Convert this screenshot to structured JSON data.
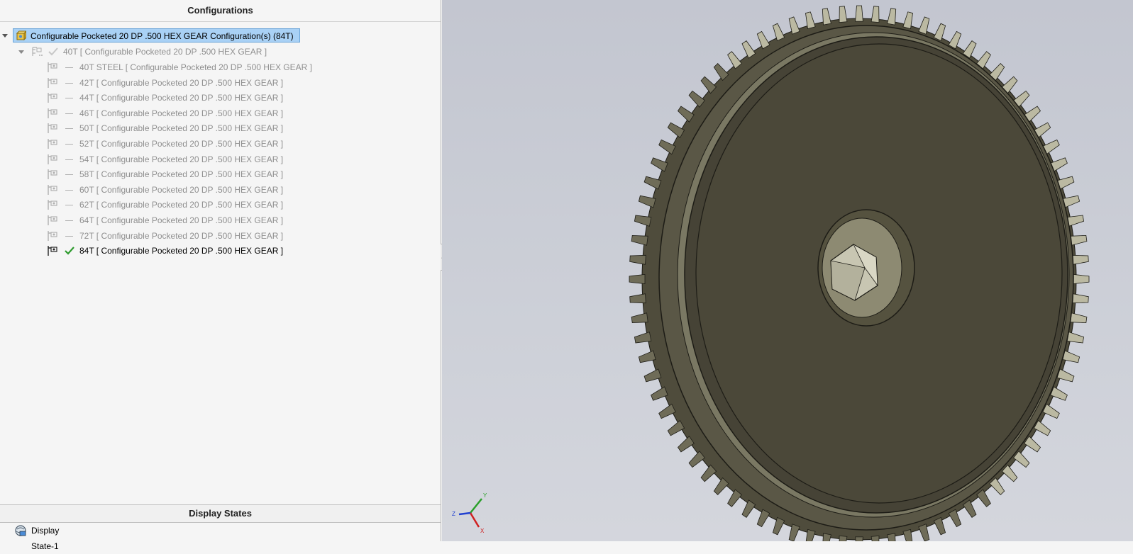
{
  "configurations_panel": {
    "header": "Configurations",
    "root": {
      "label": "Configurable Pocketed 20 DP .500 HEX GEAR Configuration(s)  (84T)"
    },
    "parent": {
      "label": "40T [ Configurable Pocketed 20 DP .500 HEX GEAR ]"
    },
    "items": [
      {
        "label": "40T STEEL [ Configurable Pocketed 20 DP .500 HEX GEAR ]",
        "active": false
      },
      {
        "label": "42T [ Configurable Pocketed 20 DP .500 HEX GEAR ]",
        "active": false
      },
      {
        "label": "44T [ Configurable Pocketed 20 DP .500 HEX GEAR ]",
        "active": false
      },
      {
        "label": "46T [ Configurable Pocketed 20 DP .500 HEX GEAR ]",
        "active": false
      },
      {
        "label": "50T [ Configurable Pocketed 20 DP .500 HEX GEAR ]",
        "active": false
      },
      {
        "label": "52T [ Configurable Pocketed 20 DP .500 HEX GEAR ]",
        "active": false
      },
      {
        "label": "54T [ Configurable Pocketed 20 DP .500 HEX GEAR ]",
        "active": false
      },
      {
        "label": "58T [ Configurable Pocketed 20 DP .500 HEX GEAR ]",
        "active": false
      },
      {
        "label": "60T [ Configurable Pocketed 20 DP .500 HEX GEAR ]",
        "active": false
      },
      {
        "label": "62T [ Configurable Pocketed 20 DP .500 HEX GEAR ]",
        "active": false
      },
      {
        "label": "64T [ Configurable Pocketed 20 DP .500 HEX GEAR ]",
        "active": false
      },
      {
        "label": "72T [ Configurable Pocketed 20 DP .500 HEX GEAR ]",
        "active": false
      },
      {
        "label": "84T [ Configurable Pocketed 20 DP .500 HEX GEAR ]",
        "active": true
      }
    ]
  },
  "display_states_panel": {
    "header": "Display States",
    "items": [
      {
        "label": "Display State-1"
      }
    ]
  },
  "viewport": {
    "model": "84T gear",
    "triad_axes": [
      "Y",
      "X",
      "Z"
    ]
  },
  "colors": {
    "selection_bg": "#a9d1f5",
    "check_active": "#2e9b2e",
    "check_inactive": "#c8c8c8",
    "gear_face": "#4a4738",
    "gear_edge": "#9a977e"
  }
}
